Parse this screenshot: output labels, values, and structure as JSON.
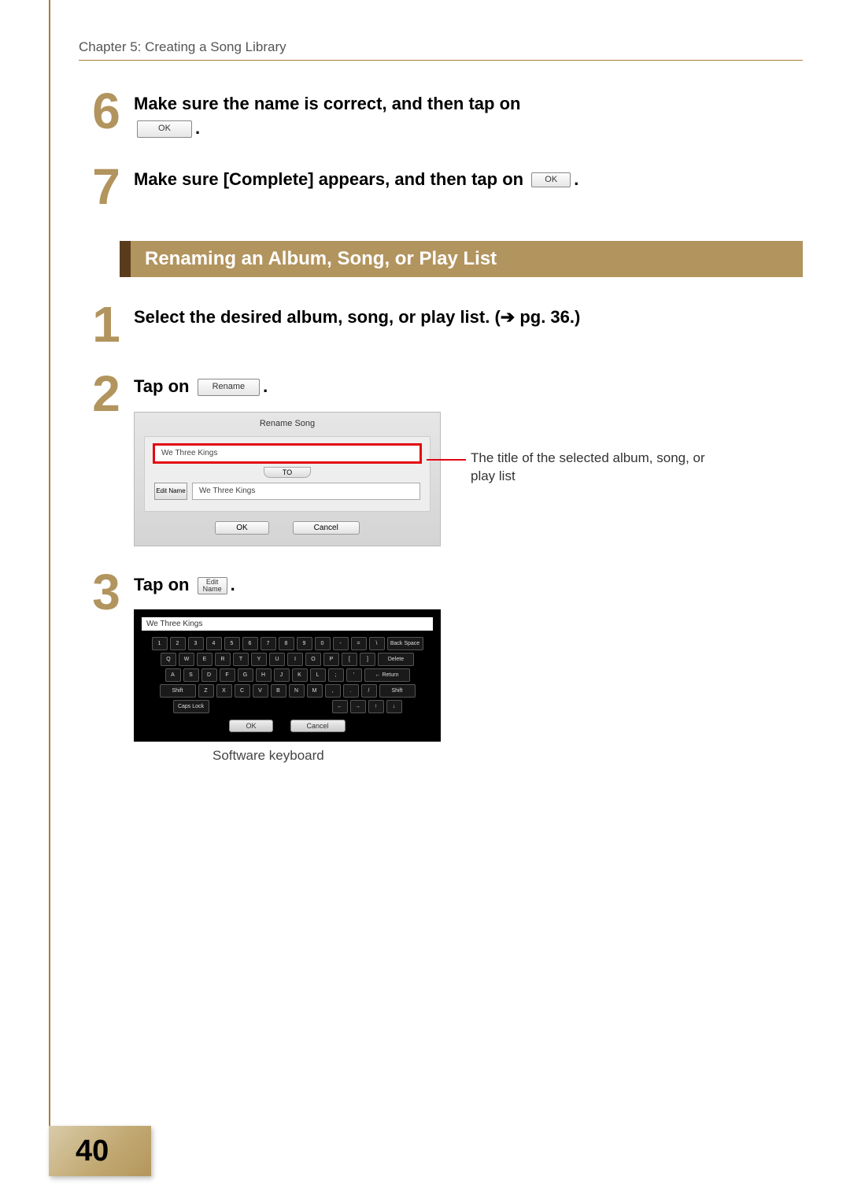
{
  "chapter_header": "Chapter 5: Creating a Song Library",
  "section_title": "Renaming an Album, Song, or Play List",
  "page_number": "40",
  "steps_a": [
    {
      "num": "6",
      "text_before": "Make sure the name is correct, and then tap on ",
      "button_label": "OK",
      "text_after": "."
    },
    {
      "num": "7",
      "text_before": "Make sure [Complete] appears, and then tap on ",
      "button_label": "OK",
      "text_after": "."
    }
  ],
  "steps_b": {
    "s1": {
      "num": "1",
      "text": "Select the desired album, song, or play list. (➔ pg. 36.)"
    },
    "s2": {
      "num": "2",
      "text_before": "Tap on ",
      "button_label": "Rename",
      "text_after": "."
    },
    "s3": {
      "num": "3",
      "text_before": "Tap on ",
      "button_label": "Edit\nName",
      "text_after": "."
    }
  },
  "rename_dialog": {
    "title": "Rename Song",
    "from_value": "We Three Kings",
    "to_label": "TO",
    "edit_name_btn": "Edit\nName",
    "to_value": "We Three Kings",
    "ok": "OK",
    "cancel": "Cancel"
  },
  "callout": "The title of the selected album, song, or play list",
  "keyboard": {
    "field_value": "We Three Kings",
    "row1": [
      "1",
      "2",
      "3",
      "4",
      "5",
      "6",
      "7",
      "8",
      "9",
      "0",
      "-",
      "=",
      "\\",
      "Back Space"
    ],
    "row2": [
      "Q",
      "W",
      "E",
      "R",
      "T",
      "Y",
      "U",
      "I",
      "O",
      "P",
      "[",
      "]",
      "Delete"
    ],
    "row3": [
      "A",
      "S",
      "D",
      "F",
      "G",
      "H",
      "J",
      "K",
      "L",
      ";",
      "'",
      "← Return"
    ],
    "row4_left": "Shift",
    "row4": [
      "Z",
      "X",
      "C",
      "V",
      "B",
      "N",
      "M",
      ",",
      ".",
      "/"
    ],
    "row4_right": "Shift",
    "row5_left": "Caps Lock",
    "arrows": [
      "←",
      "→",
      "↑",
      "↓"
    ],
    "ok": "OK",
    "cancel": "Cancel",
    "caption": "Software keyboard"
  }
}
